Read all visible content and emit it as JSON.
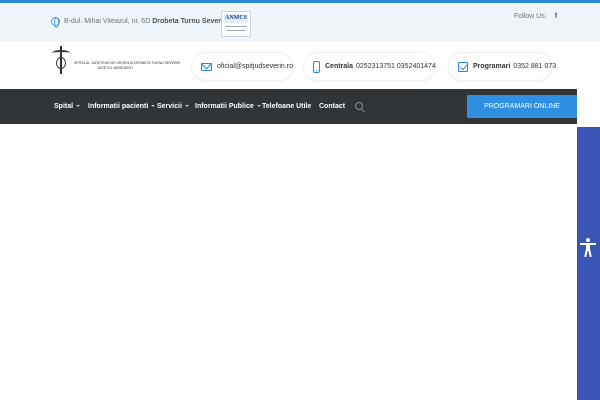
{
  "topbar": {
    "address_prefix": "B-dul. Mihai Viteazul, nr. 6D",
    "address_city": "Drobeta Turnu Severin",
    "anmcs_logo_text": "ANMCS",
    "follow_label": "Follow Us:",
    "facebook_glyph": "f"
  },
  "header": {
    "logo_line1": "SPITALUL JUDETEAN DE URGENTA DROBETA TURNU SEVERIN",
    "logo_line2": "JUDETUL MEHEDINTI",
    "email": "oficial@spitjudseverin.ro",
    "phone_label": "Centrala",
    "phone_numbers": "0252313751 0352401474",
    "appointments_label": "Programari",
    "appointments_number": "0352 881 073"
  },
  "nav": {
    "items": [
      {
        "label": "Spital",
        "has_dropdown": true
      },
      {
        "label": "Informatii pacienti",
        "has_dropdown": true
      },
      {
        "label": "Servicii",
        "has_dropdown": true
      },
      {
        "label": "Informatii Publice",
        "has_dropdown": true
      },
      {
        "label": "Telefoane Utile",
        "has_dropdown": false
      },
      {
        "label": "Contact",
        "has_dropdown": false
      }
    ],
    "cta_label": "PROGRAMARI ONLINE"
  },
  "colors": {
    "accent": "#2c86d9",
    "nav_bg": "#323537",
    "cta_bg": "#2f8fe0",
    "accessibility_bar": "#3a55b4"
  },
  "icons": {
    "address": "globe-icon",
    "email": "mail-icon",
    "phone": "phone-icon",
    "appointments": "checkbox-icon",
    "search": "search-icon",
    "accessibility": "accessibility-icon"
  }
}
